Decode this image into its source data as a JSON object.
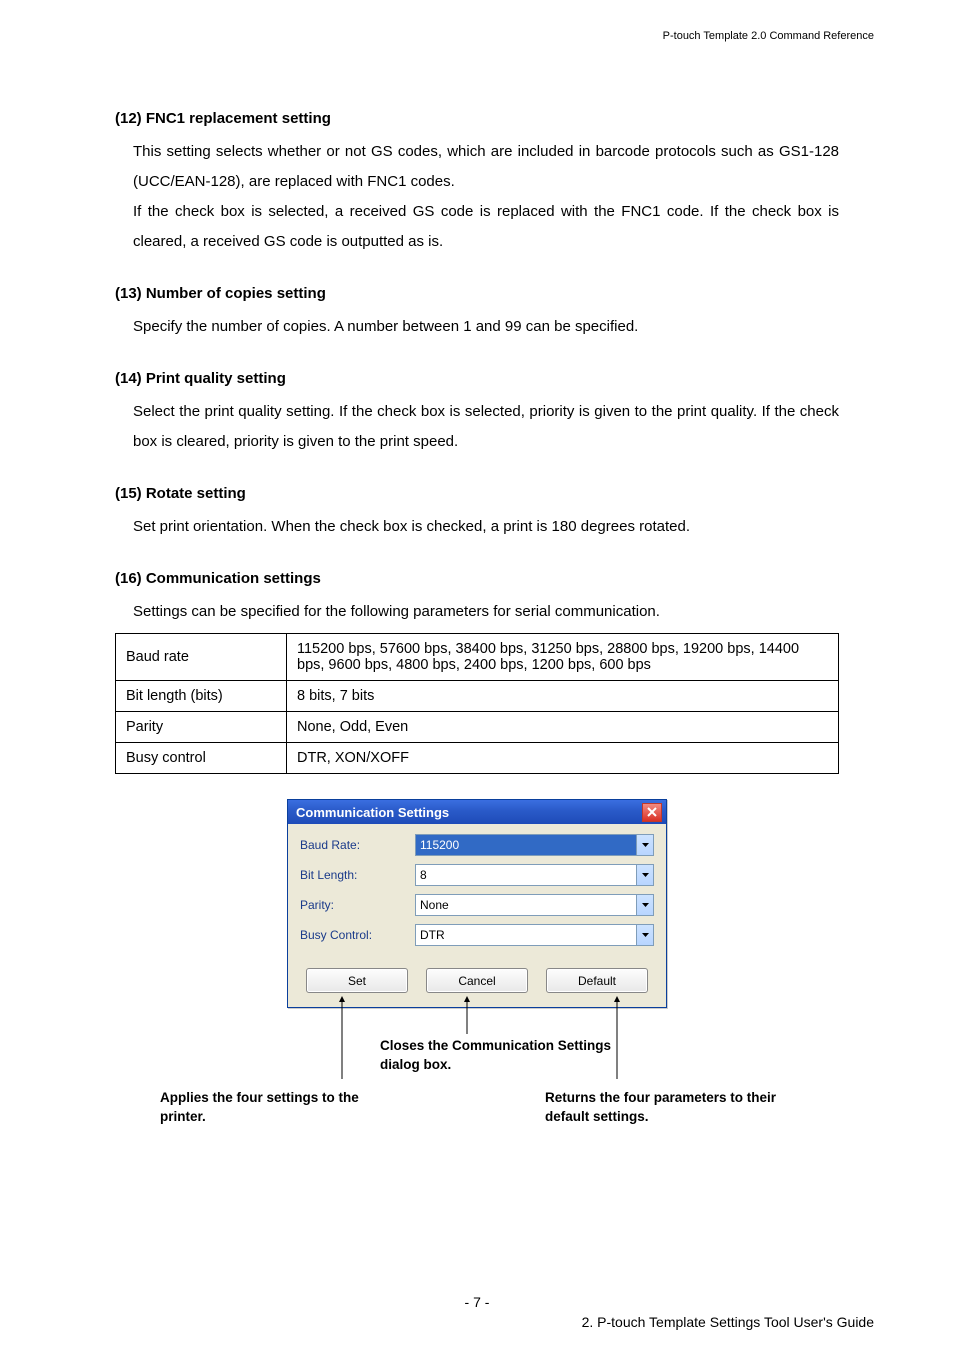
{
  "headerRight": "P-touch Template 2.0 Command Reference",
  "s12": {
    "title": "(12) FNC1 replacement setting",
    "body": "This setting selects whether or not GS codes, which are included in barcode protocols such as GS1-128 (UCC/EAN-128), are replaced with FNC1 codes.\nIf the check box is selected, a received GS code is replaced with the FNC1 code. If the check box is cleared, a received GS code is outputted as is."
  },
  "s13": {
    "title": "(13) Number of copies setting",
    "body": "Specify the number of copies. A number between 1 and 99 can be specified."
  },
  "s14": {
    "title": "(14) Print quality setting",
    "body": "Select the print quality setting. If the check box is selected, priority is given to the print quality. If the check box is cleared, priority is given to the print speed."
  },
  "s15": {
    "title": "(15) Rotate setting",
    "body": "Set print orientation. When the check box is checked, a print is 180 degrees rotated."
  },
  "s16": {
    "title": "(16) Communication settings",
    "body": "Settings can be specified for the following parameters for serial communication."
  },
  "table": {
    "r1k": "Baud rate",
    "r1v": "115200 bps, 57600 bps, 38400 bps, 31250 bps, 28800 bps, 19200 bps, 14400 bps, 9600 bps, 4800 bps, 2400 bps, 1200 bps, 600 bps",
    "r2k": "Bit length (bits)",
    "r2v": "8 bits, 7 bits",
    "r3k": "Parity",
    "r3v": "None, Odd, Even",
    "r4k": "Busy control",
    "r4v": "DTR, XON/XOFF"
  },
  "dialog": {
    "title": "Communication Settings",
    "baudLabel": "Baud Rate:",
    "baudValue": "115200",
    "bitLabel": "Bit Length:",
    "bitValue": "8",
    "parityLabel": "Parity:",
    "parityValue": "None",
    "busyLabel": "Busy Control:",
    "busyValue": "DTR",
    "setBtn": "Set",
    "cancelBtn": "Cancel",
    "defaultBtn": "Default"
  },
  "callouts": {
    "cancel": "Closes the Communication Settings dialog box.",
    "set": "Applies the four settings to the printer.",
    "def": "Returns the four parameters to their default settings."
  },
  "pageNum": "- 7 -",
  "footRight": "2. P-touch Template Settings Tool User's Guide"
}
